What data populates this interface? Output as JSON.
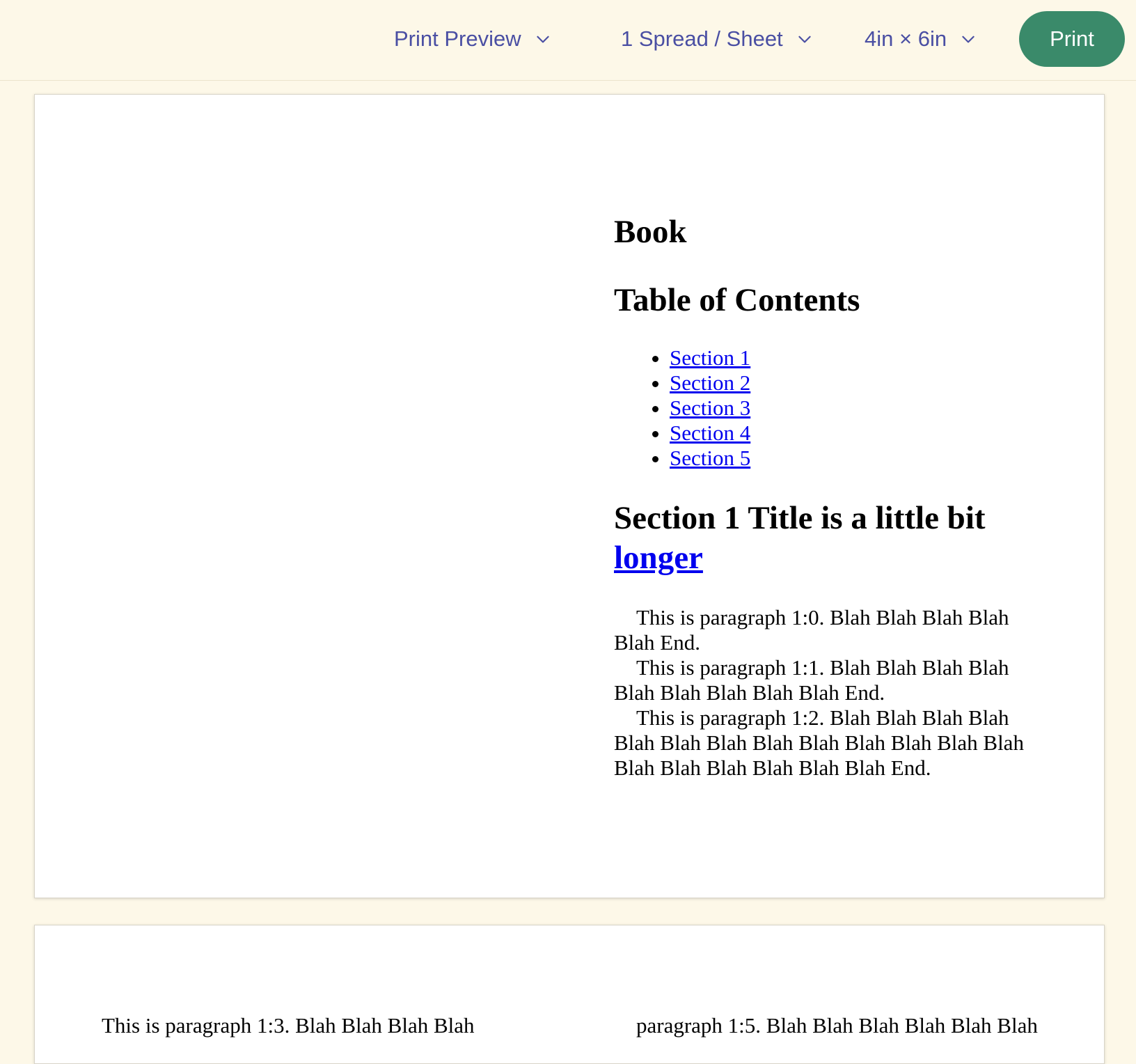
{
  "toolbar": {
    "view_mode": "Print Preview",
    "layout": "1 Spread / Sheet",
    "page_size": "4in × 6in",
    "print_label": "Print"
  },
  "sheet1": {
    "book_title": "Book",
    "toc_title": "Table of Contents",
    "toc_items": [
      "Section 1",
      "Section 2",
      "Section 3",
      "Section 4",
      "Section 5"
    ],
    "section_title_text": "Section 1 Title is a little bit ",
    "section_title_link": "longer",
    "paragraphs": [
      "This is paragraph 1:0. Blah Blah Blah Blah Blah End.",
      "This is paragraph 1:1. Blah Blah Blah Blah Blah Blah Blah Blah Blah End.",
      "This is paragraph 1:2. Blah Blah Blah Blah Blah Blah Blah Blah Blah Blah Blah Blah Blah Blah Blah Blah Blah Blah Blah End."
    ]
  },
  "sheet2": {
    "left_text": "This is paragraph 1:3. Blah Blah Blah Blah",
    "right_text": "paragraph 1:5. Blah Blah Blah Blah Blah Blah"
  },
  "icons": {
    "chevron": "chevron-down-icon"
  },
  "colors": {
    "background": "#fdf8e8",
    "accent_text": "#4a4fa3",
    "print_button": "#3a8a6a",
    "link": "#0000ee"
  }
}
